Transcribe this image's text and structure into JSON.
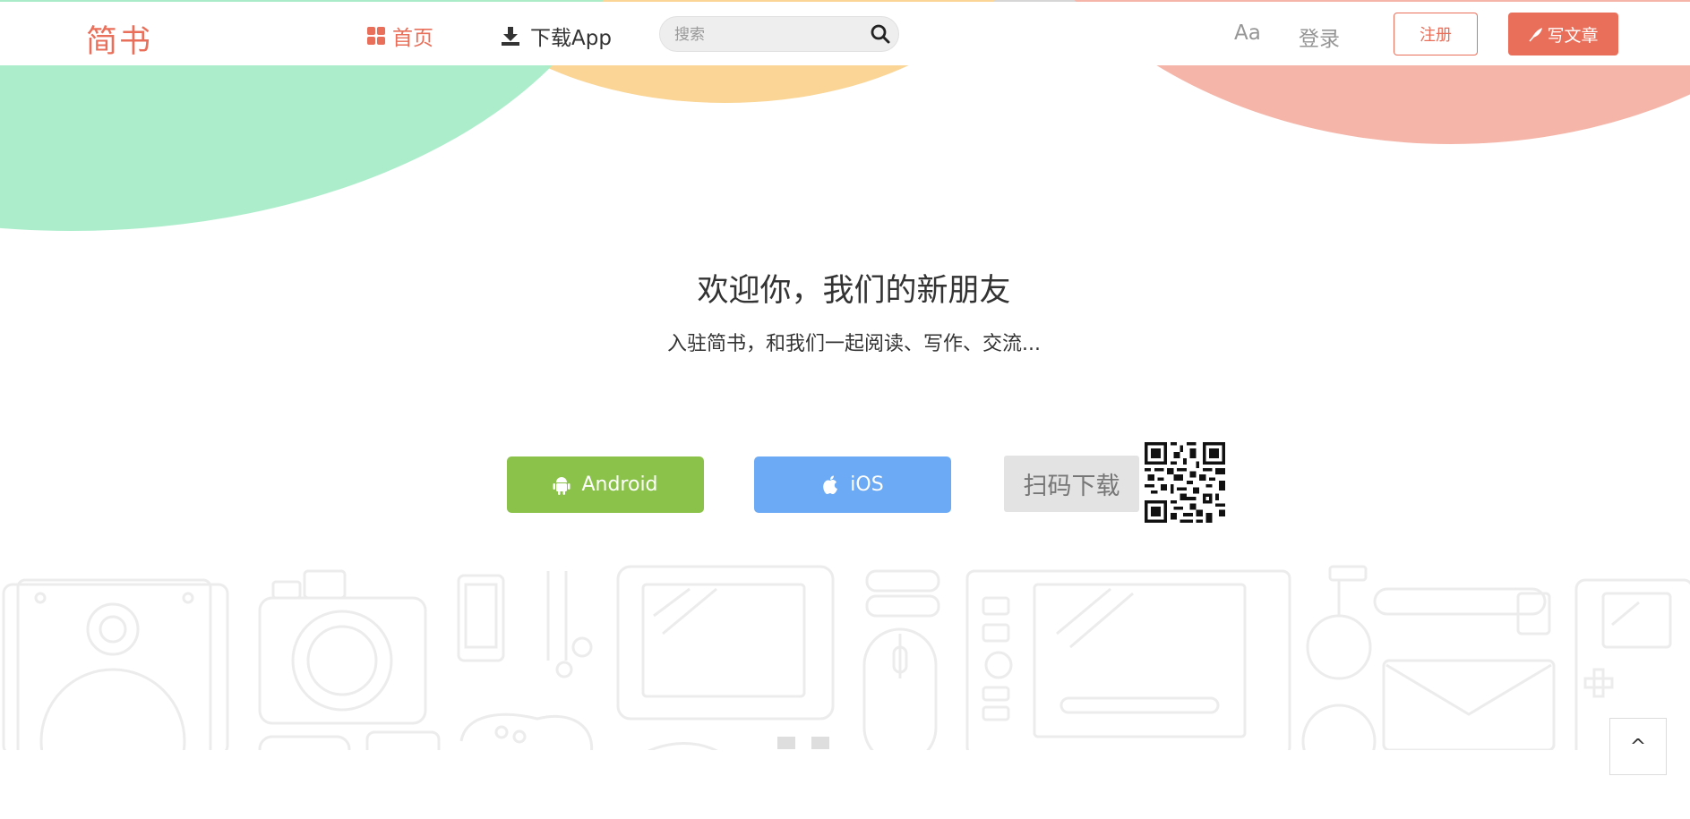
{
  "header": {
    "logo": "简书",
    "nav_home": "首页",
    "nav_download": "下载App",
    "search_placeholder": "搜索",
    "font_toggle": "Aa",
    "login": "登录",
    "signup": "注册",
    "write": "写文章"
  },
  "hero": {
    "title": "欢迎你，我们的新朋友",
    "subtitle": "入驻简书，和我们一起阅读、写作、交流..."
  },
  "downloads": {
    "android_label": "Android",
    "ios_label": "iOS",
    "scan_label": "扫码下载"
  },
  "back_to_top": "^",
  "colors": {
    "brand": "#ea6f5a",
    "android": "#8bc34a",
    "ios": "#6daaf5",
    "arc_green": "#a8edc9",
    "arc_yellow": "#fad595",
    "arc_pink": "#f5b6a9"
  }
}
